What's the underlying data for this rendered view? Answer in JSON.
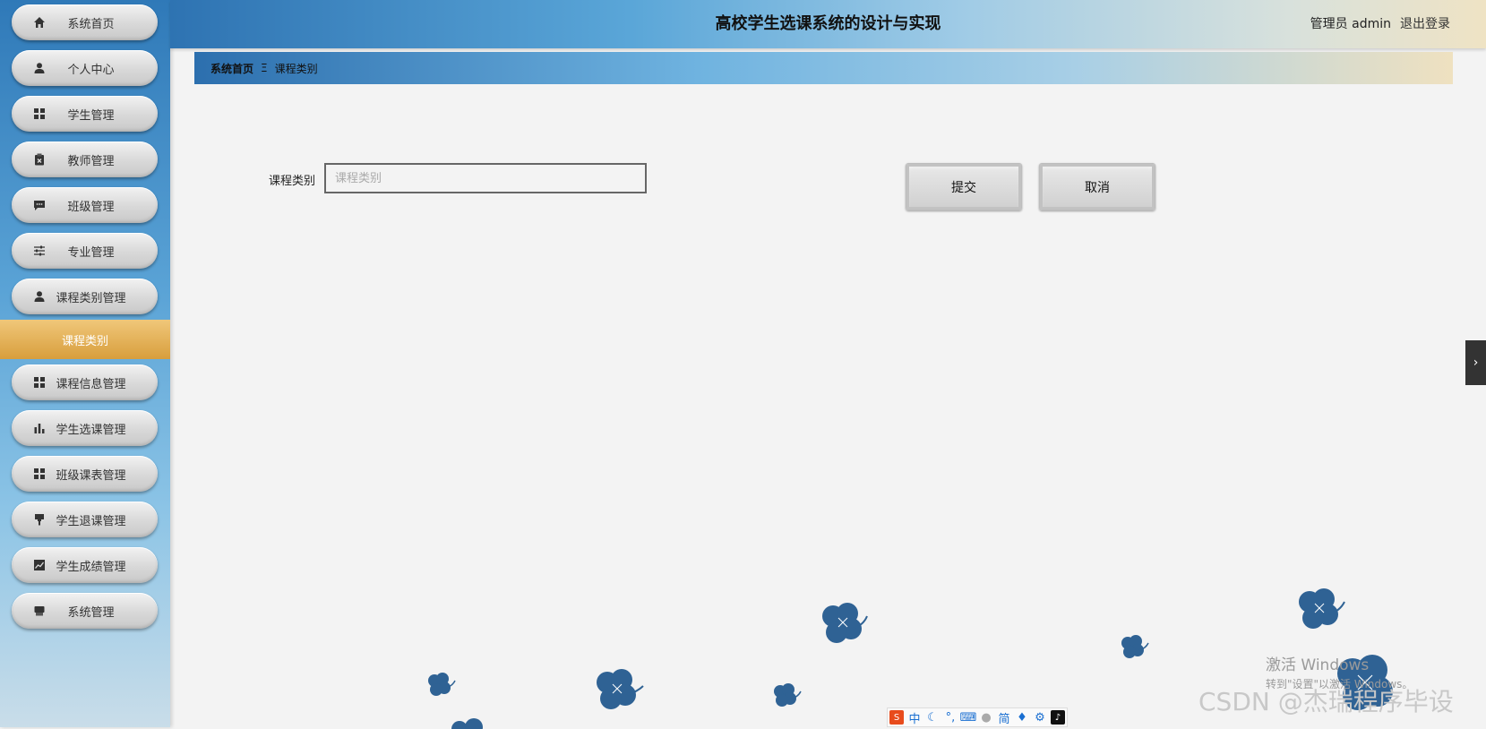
{
  "header": {
    "title": "高校学生选课系统的设计与实现",
    "user": "管理员 admin",
    "logout": "退出登录"
  },
  "sidebar": {
    "items": [
      {
        "label": "系统首页",
        "icon": "home-icon"
      },
      {
        "label": "个人中心",
        "icon": "user-icon"
      },
      {
        "label": "学生管理",
        "icon": "grid-icon"
      },
      {
        "label": "教师管理",
        "icon": "clipboard-icon"
      },
      {
        "label": "班级管理",
        "icon": "comment-icon"
      },
      {
        "label": "专业管理",
        "icon": "sliders-icon"
      },
      {
        "label": "课程类别管理",
        "icon": "user-icon"
      }
    ],
    "active_sub": "课程类别",
    "items_after": [
      {
        "label": "课程信息管理",
        "icon": "grid-icon"
      },
      {
        "label": "学生选课管理",
        "icon": "bar-chart-icon"
      },
      {
        "label": "班级课表管理",
        "icon": "grid-icon"
      },
      {
        "label": "学生退课管理",
        "icon": "pin-icon"
      },
      {
        "label": "学生成绩管理",
        "icon": "line-chart-icon"
      },
      {
        "label": "系统管理",
        "icon": "archive-icon"
      }
    ]
  },
  "breadcrumb": {
    "home": "系统首页",
    "separator": "Ξ",
    "current": "课程类别"
  },
  "form": {
    "label": "课程类别",
    "placeholder": "课程类别",
    "value": ""
  },
  "buttons": {
    "submit": "提交",
    "cancel": "取消"
  },
  "side_toggle": "›",
  "watermarks": {
    "windows_line1": "激活 Windows",
    "windows_line2": "转到\"设置\"以激活 Windows。",
    "csdn": "CSDN @杰瑞程序毕设"
  },
  "ime": {
    "items": [
      "中",
      "简"
    ]
  },
  "colors": {
    "accent": "#d89e3c",
    "header_start": "#2e73b2",
    "flower": "#2f6294"
  }
}
